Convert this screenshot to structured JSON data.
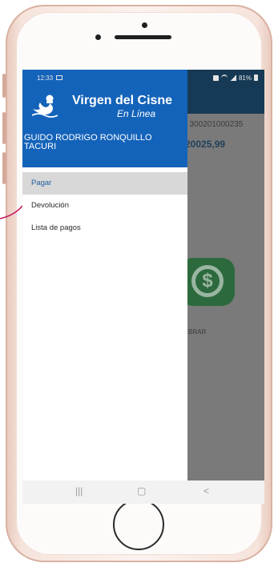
{
  "status_bar": {
    "time": "12:33",
    "battery_label": "81%"
  },
  "drawer": {
    "brand_name": "Virgen del Cisne",
    "brand_subtitle": "En Línea",
    "user_name": "GUIDO RODRIGO RONQUILLO TACURI",
    "menu_items": [
      {
        "label": "Pagar",
        "active": true
      },
      {
        "label": "Devolución",
        "active": false
      },
      {
        "label": "Lista de pagos",
        "active": false
      }
    ]
  },
  "background_screen": {
    "account_text": ": 300201000235",
    "amount_text": "20025,99",
    "button_icon_symbol": "$",
    "button_label": "BRAR"
  },
  "nav_bar": {
    "recents": "|||",
    "home": "▢",
    "back": "<"
  },
  "colors": {
    "drawer_header": "#1463ba",
    "app_header": "#163a55",
    "active_item": "#d8d8d8",
    "app_icon": "#2c6a3d"
  }
}
